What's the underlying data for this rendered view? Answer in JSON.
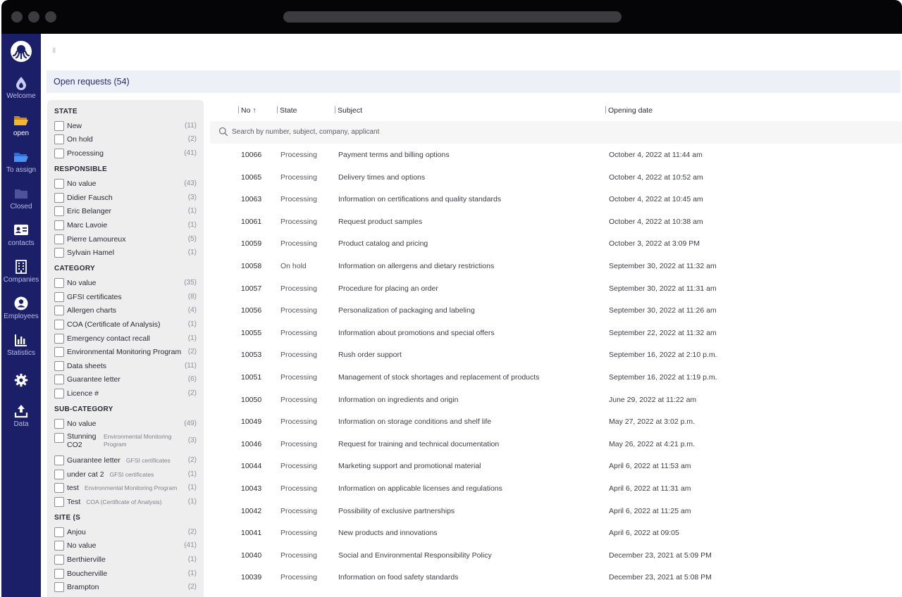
{
  "nav": [
    {
      "label": "Welcome",
      "icon": "drop-icon"
    },
    {
      "label": "open",
      "icon": "folder-open-icon"
    },
    {
      "label": "To assign",
      "icon": "folder-open-icon"
    },
    {
      "label": "Closed",
      "icon": "folder-icon"
    },
    {
      "label": "contacts",
      "icon": "contact-card-icon"
    },
    {
      "label": "Companies",
      "icon": "building-icon"
    },
    {
      "label": "Employees",
      "icon": "person-icon"
    },
    {
      "label": "Statistics",
      "icon": "bar-chart-icon"
    },
    {
      "label": "",
      "icon": "gear-icon"
    },
    {
      "label": "Data",
      "icon": "upload-icon"
    }
  ],
  "colors": {
    "nav_bg": "#1b1f68",
    "title": "#232a78",
    "folder": "#f2b632"
  },
  "page": {
    "title": "Open requests (54)"
  },
  "filters": {
    "state": {
      "title": "STATE",
      "items": [
        {
          "label": "New",
          "count": "(11)"
        },
        {
          "label": "On hold",
          "count": "(2)"
        },
        {
          "label": "Processing",
          "count": "(41)"
        }
      ]
    },
    "responsible": {
      "title": "RESPONSIBLE",
      "items": [
        {
          "label": "No value",
          "count": "(43)"
        },
        {
          "label": "Didier Fausch",
          "count": "(3)"
        },
        {
          "label": "Eric Belanger",
          "count": "(1)"
        },
        {
          "label": "Marc Lavoie",
          "count": "(1)"
        },
        {
          "label": "Pierre Lamoureux",
          "count": "(5)"
        },
        {
          "label": "Sylvain Hamel",
          "count": "(1)"
        }
      ]
    },
    "category": {
      "title": "CATEGORY",
      "items": [
        {
          "label": "No value",
          "count": "(35)"
        },
        {
          "label": "GFSI certificates",
          "count": "(8)"
        },
        {
          "label": "Allergen charts",
          "count": "(4)"
        },
        {
          "label": "COA (Certificate of Analysis)",
          "count": "(1)"
        },
        {
          "label": "Emergency contact recall",
          "count": "(1)"
        },
        {
          "label": "Environmental Monitoring Program",
          "count": "(2)"
        },
        {
          "label": "Data sheets",
          "count": "(11)"
        },
        {
          "label": "Guarantee letter",
          "count": "(6)"
        },
        {
          "label": "Licence #",
          "count": "(2)"
        }
      ]
    },
    "subcategory": {
      "title": "SUB-CATEGORY",
      "items": [
        {
          "label": "No value",
          "sub": "",
          "count": "(49)"
        },
        {
          "label": "Stunning CO2",
          "sub": "Environmental Monitoring Program",
          "count": "(3)"
        },
        {
          "label": "Guarantee letter",
          "sub": "GFSI certificates",
          "count": "(2)"
        },
        {
          "label": "under cat 2",
          "sub": "GFSI certificates",
          "count": "(1)"
        },
        {
          "label": "test",
          "sub": "Environmental Monitoring Program",
          "count": "(1)"
        },
        {
          "label": "Test",
          "sub": "COA (Certificate of Analysis)",
          "count": "(1)"
        }
      ]
    },
    "site": {
      "title": "SITE (S",
      "items": [
        {
          "label": "Anjou",
          "count": "(2)"
        },
        {
          "label": "No value",
          "count": "(41)"
        },
        {
          "label": "Berthierville",
          "count": "(1)"
        },
        {
          "label": "Boucherville",
          "count": "(1)"
        },
        {
          "label": "Brampton",
          "count": "(2)"
        }
      ]
    }
  },
  "table": {
    "columns": {
      "no": "No ↑",
      "state": "State",
      "subject": "Subject",
      "date": "Opening date"
    },
    "search_placeholder": "Search by number, subject, company, applicant",
    "rows": [
      {
        "no": "10066",
        "state": "Processing",
        "subject": "Payment terms and billing options",
        "date": "October 4, 2022 at 11:44 am"
      },
      {
        "no": "10065",
        "state": "Processing",
        "subject": "Delivery times and options",
        "date": "October 4, 2022 at 10:52 am"
      },
      {
        "no": "10063",
        "state": "Processing",
        "subject": "Information on certifications and quality standards",
        "date": "October 4, 2022 at 10:45 am"
      },
      {
        "no": "10061",
        "state": "Processing",
        "subject": "Request product samples",
        "date": "October 4, 2022 at 10:38 am"
      },
      {
        "no": "10059",
        "state": "Processing",
        "subject": "Product catalog and pricing",
        "date": "October 3, 2022 at 3:09 PM"
      },
      {
        "no": "10058",
        "state": "On hold",
        "subject": "Information on allergens and dietary restrictions",
        "date": "September 30, 2022 at 11:32 am"
      },
      {
        "no": "10057",
        "state": "Processing",
        "subject": "Procedure for placing an order",
        "date": "September 30, 2022 at 11:31 am"
      },
      {
        "no": "10056",
        "state": "Processing",
        "subject": "Personalization of packaging and labeling",
        "date": "September 30, 2022 at 11:26 am"
      },
      {
        "no": "10055",
        "state": "Processing",
        "subject": "Information about promotions and special offers",
        "date": "September 22, 2022 at 11:32 am"
      },
      {
        "no": "10053",
        "state": "Processing",
        "subject": "Rush order support",
        "date": "September 16, 2022 at 2:10 p.m."
      },
      {
        "no": "10051",
        "state": "Processing",
        "subject": "Management of stock shortages and replacement of products",
        "date": "September 16, 2022 at 1:19 p.m."
      },
      {
        "no": "10050",
        "state": "Processing",
        "subject": "Information on ingredients and origin",
        "date": "June 29, 2022 at 11:22 am"
      },
      {
        "no": "10049",
        "state": "Processing",
        "subject": "Information on storage conditions and shelf life",
        "date": "May 27, 2022 at 3:02 p.m."
      },
      {
        "no": "10046",
        "state": "Processing",
        "subject": "Request for training and technical documentation",
        "date": "May 26, 2022 at 4:21 p.m."
      },
      {
        "no": "10044",
        "state": "Processing",
        "subject": "Marketing support and promotional material",
        "date": "April 6, 2022 at 11:53 am"
      },
      {
        "no": "10043",
        "state": "Processing",
        "subject": "Information on applicable licenses and regulations",
        "date": "April 6, 2022 at 11:31 am"
      },
      {
        "no": "10042",
        "state": "Processing",
        "subject": "Possibility of exclusive partnerships",
        "date": "April 6, 2022 at 11:25 am"
      },
      {
        "no": "10041",
        "state": "Processing",
        "subject": "New products and innovations",
        "date": "April 6, 2022 at 09:05"
      },
      {
        "no": "10040",
        "state": "Processing",
        "subject": "Social and Environmental Responsibility Policy",
        "date": "December 23, 2021 at 5:09 PM"
      },
      {
        "no": "10039",
        "state": "Processing",
        "subject": "Information on food safety standards",
        "date": "December 23, 2021 at 5:08 PM"
      }
    ]
  }
}
